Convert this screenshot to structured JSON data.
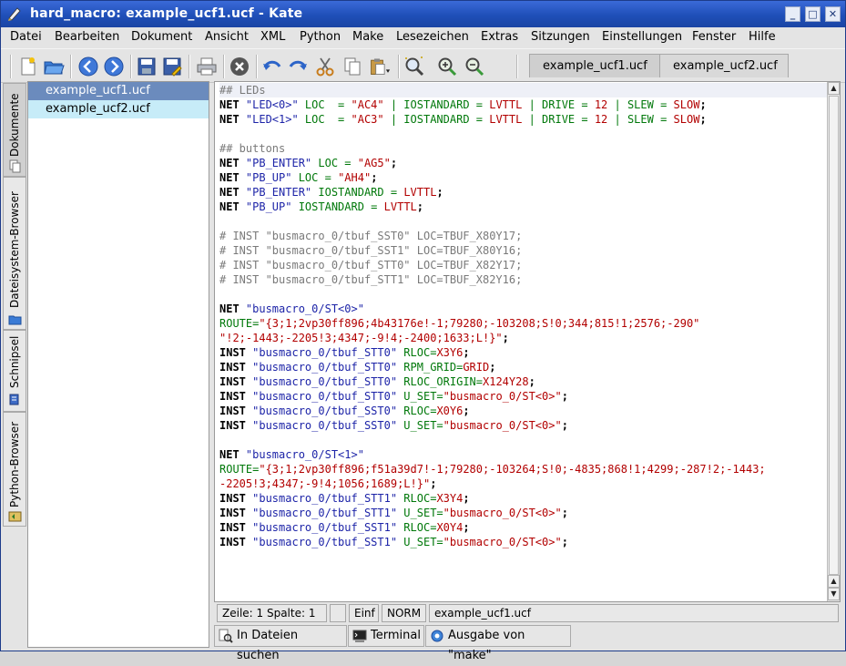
{
  "window": {
    "title": "hard_macro: example_ucf1.ucf - Kate",
    "buttons": [
      "_",
      "□",
      "✕"
    ]
  },
  "menu": [
    "Datei",
    "Bearbeiten",
    "Dokument",
    "Ansicht",
    "XML",
    "Python",
    "Make",
    "Lesezeichen",
    "Extras",
    "Sitzungen",
    "Einstellungen",
    "Fenster",
    "Hilfe"
  ],
  "toolbar": {
    "icons": [
      "new-file-icon",
      "open-folder-icon",
      "back-arrow-icon",
      "forward-arrow-icon",
      "save-icon",
      "save-as-icon",
      "print-icon",
      "close-doc-icon",
      "undo-icon",
      "redo-icon",
      "cut-icon",
      "copy-icon",
      "paste-icon",
      "find-icon",
      "zoom-in-icon",
      "zoom-out-icon"
    ]
  },
  "doc_tabs": [
    "example_ucf1.ucf",
    "example_ucf2.ucf"
  ],
  "side_tabs": [
    "Dokumente",
    "Dateisystem-Browser",
    "Schnipsel",
    "Python-Browser"
  ],
  "file_list": [
    "example_ucf1.ucf",
    "example_ucf2.ucf"
  ],
  "code_lines": [
    [
      [
        "cmt",
        "## LEDs"
      ]
    ],
    [
      [
        "kw",
        "NET "
      ],
      [
        "str",
        "\"LED<0>\""
      ],
      [
        "grn",
        " LOC  = "
      ],
      [
        "red",
        "\"AC4\""
      ],
      [
        "grn",
        " | IOSTANDARD = "
      ],
      [
        "red",
        "LVTTL"
      ],
      [
        "grn",
        " | DRIVE = "
      ],
      [
        "red",
        "12"
      ],
      [
        "grn",
        " | SLEW = "
      ],
      [
        "red",
        "SLOW"
      ],
      [
        "kw",
        ";"
      ]
    ],
    [
      [
        "kw",
        "NET "
      ],
      [
        "str",
        "\"LED<1>\""
      ],
      [
        "grn",
        " LOC  = "
      ],
      [
        "red",
        "\"AC3\""
      ],
      [
        "grn",
        " | IOSTANDARD = "
      ],
      [
        "red",
        "LVTTL"
      ],
      [
        "grn",
        " | DRIVE = "
      ],
      [
        "red",
        "12"
      ],
      [
        "grn",
        " | SLEW = "
      ],
      [
        "red",
        "SLOW"
      ],
      [
        "kw",
        ";"
      ]
    ],
    [],
    [
      [
        "cmt",
        "## buttons"
      ]
    ],
    [
      [
        "kw",
        "NET "
      ],
      [
        "str",
        "\"PB_ENTER\""
      ],
      [
        "grn",
        " LOC = "
      ],
      [
        "red",
        "\"AG5\""
      ],
      [
        "kw",
        ";"
      ]
    ],
    [
      [
        "kw",
        "NET "
      ],
      [
        "str",
        "\"PB_UP\""
      ],
      [
        "grn",
        " LOC = "
      ],
      [
        "red",
        "\"AH4\""
      ],
      [
        "kw",
        ";"
      ]
    ],
    [
      [
        "kw",
        "NET "
      ],
      [
        "str",
        "\"PB_ENTER\""
      ],
      [
        "grn",
        " IOSTANDARD = "
      ],
      [
        "red",
        "LVTTL"
      ],
      [
        "kw",
        ";"
      ]
    ],
    [
      [
        "kw",
        "NET "
      ],
      [
        "str",
        "\"PB_UP\""
      ],
      [
        "grn",
        " IOSTANDARD = "
      ],
      [
        "red",
        "LVTTL"
      ],
      [
        "kw",
        ";"
      ]
    ],
    [],
    [
      [
        "cmt",
        "# INST \"busmacro_0/tbuf_SST0\" LOC=TBUF_X80Y17;"
      ]
    ],
    [
      [
        "cmt",
        "# INST \"busmacro_0/tbuf_SST1\" LOC=TBUF_X80Y16;"
      ]
    ],
    [
      [
        "cmt",
        "# INST \"busmacro_0/tbuf_STT0\" LOC=TBUF_X82Y17;"
      ]
    ],
    [
      [
        "cmt",
        "# INST \"busmacro_0/tbuf_STT1\" LOC=TBUF_X82Y16;"
      ]
    ],
    [],
    [
      [
        "kw",
        "NET "
      ],
      [
        "str",
        "\"busmacro_0/ST<0>\""
      ]
    ],
    [
      [
        "grn",
        "ROUTE="
      ],
      [
        "red",
        "\"{3;1;2vp30ff896;4b43176e!-1;79280;-103208;S!0;344;815!1;2576;-290\""
      ]
    ],
    [
      [
        "red",
        "\"!2;-1443;-2205!3;4347;-9!4;-2400;1633;L!}\""
      ],
      [
        "kw",
        ";"
      ]
    ],
    [
      [
        "kw",
        "INST "
      ],
      [
        "str",
        "\"busmacro_0/tbuf_STT0\""
      ],
      [
        "grn",
        " RLOC="
      ],
      [
        "red",
        "X3Y6"
      ],
      [
        "kw",
        ";"
      ]
    ],
    [
      [
        "kw",
        "INST "
      ],
      [
        "str",
        "\"busmacro_0/tbuf_STT0\""
      ],
      [
        "grn",
        " RPM_GRID="
      ],
      [
        "red",
        "GRID"
      ],
      [
        "kw",
        ";"
      ]
    ],
    [
      [
        "kw",
        "INST "
      ],
      [
        "str",
        "\"busmacro_0/tbuf_STT0\""
      ],
      [
        "grn",
        " RLOC_ORIGIN="
      ],
      [
        "red",
        "X124Y28"
      ],
      [
        "kw",
        ";"
      ]
    ],
    [
      [
        "kw",
        "INST "
      ],
      [
        "str",
        "\"busmacro_0/tbuf_STT0\""
      ],
      [
        "grn",
        " U_SET="
      ],
      [
        "red",
        "\"busmacro_0/ST<0>\""
      ],
      [
        "kw",
        ";"
      ]
    ],
    [
      [
        "kw",
        "INST "
      ],
      [
        "str",
        "\"busmacro_0/tbuf_SST0\""
      ],
      [
        "grn",
        " RLOC="
      ],
      [
        "red",
        "X0Y6"
      ],
      [
        "kw",
        ";"
      ]
    ],
    [
      [
        "kw",
        "INST "
      ],
      [
        "str",
        "\"busmacro_0/tbuf_SST0\""
      ],
      [
        "grn",
        " U_SET="
      ],
      [
        "red",
        "\"busmacro_0/ST<0>\""
      ],
      [
        "kw",
        ";"
      ]
    ],
    [],
    [
      [
        "kw",
        "NET "
      ],
      [
        "str",
        "\"busmacro_0/ST<1>\""
      ]
    ],
    [
      [
        "grn",
        "ROUTE="
      ],
      [
        "red",
        "\"{3;1;2vp30ff896;f51a39d7!-1;79280;-103264;S!0;-4835;868!1;4299;-287!2;-1443;"
      ]
    ],
    [
      [
        "red",
        "-2205!3;4347;-9!4;1056;1689;L!}\""
      ],
      [
        "kw",
        ";"
      ]
    ],
    [
      [
        "kw",
        "INST "
      ],
      [
        "str",
        "\"busmacro_0/tbuf_STT1\""
      ],
      [
        "grn",
        " RLOC="
      ],
      [
        "red",
        "X3Y4"
      ],
      [
        "kw",
        ";"
      ]
    ],
    [
      [
        "kw",
        "INST "
      ],
      [
        "str",
        "\"busmacro_0/tbuf_STT1\""
      ],
      [
        "grn",
        " U_SET="
      ],
      [
        "red",
        "\"busmacro_0/ST<0>\""
      ],
      [
        "kw",
        ";"
      ]
    ],
    [
      [
        "kw",
        "INST "
      ],
      [
        "str",
        "\"busmacro_0/tbuf_SST1\""
      ],
      [
        "grn",
        " RLOC="
      ],
      [
        "red",
        "X0Y4"
      ],
      [
        "kw",
        ";"
      ]
    ],
    [
      [
        "kw",
        "INST "
      ],
      [
        "str",
        "\"busmacro_0/tbuf_SST1\""
      ],
      [
        "grn",
        " U_SET="
      ],
      [
        "red",
        "\"busmacro_0/ST<0>\""
      ],
      [
        "kw",
        ";"
      ]
    ]
  ],
  "status": {
    "position": "Zeile: 1 Spalte: 1",
    "mode_blank": "",
    "insert": "Einf",
    "norm": "NORM",
    "file": "example_ucf1.ucf"
  },
  "bottom_tabs": [
    "In Dateien suchen",
    "Terminal",
    "Ausgabe von \"make\""
  ],
  "colors": {
    "title_bar": "#1f4fb8",
    "selected_file": "#6b8bbd",
    "alt_file": "#c7ecf8",
    "keyword_green": "#00780a",
    "value_red": "#b20000",
    "string_blue": "#1d24a8",
    "comment_grey": "#7a7a7a"
  }
}
